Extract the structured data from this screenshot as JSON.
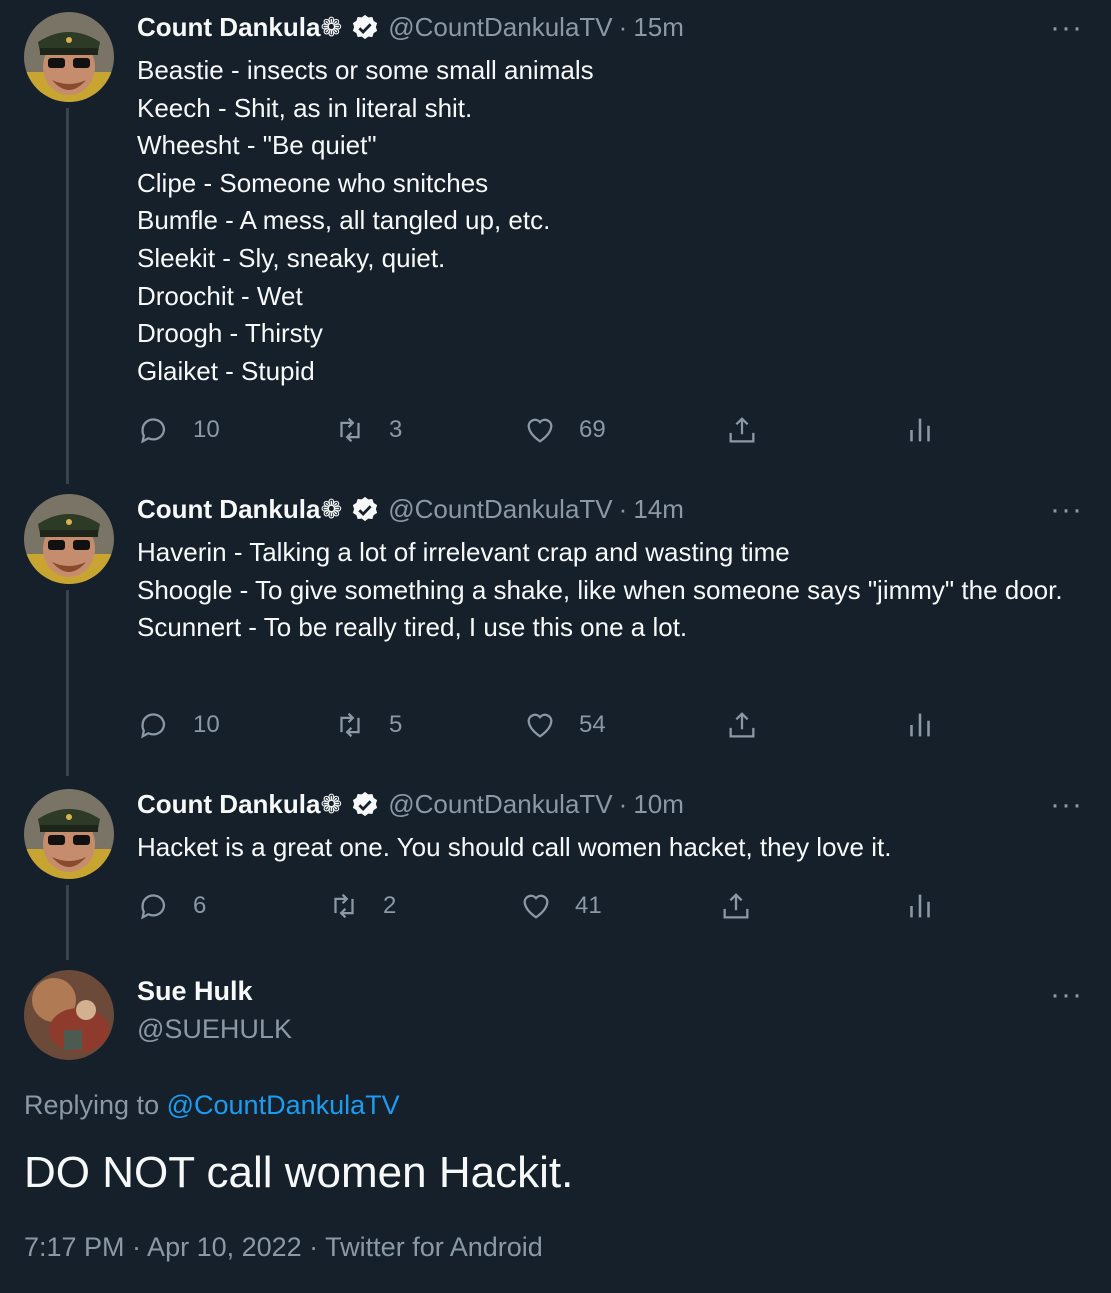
{
  "thread": [
    {
      "name": "Count Dankula🚖",
      "name_text": "Count Dankula",
      "name_emoji": "❁",
      "handle": "@CountDankulaTV",
      "time": "15m",
      "lines": [
        "Beastie - insects or some small animals",
        "Keech - Shit, as in literal shit.",
        "Wheesht - \"Be quiet\"",
        "Clipe - Someone who snitches",
        "Bumfle - A mess, all tangled up, etc.",
        "Sleekit - Sly, sneaky, quiet.",
        "Droochit - Wet",
        "Droogh - Thirsty",
        "Glaiket - Stupid"
      ],
      "replies": "10",
      "retweets": "3",
      "likes": "69"
    },
    {
      "name_text": "Count Dankula",
      "name_emoji": "❁",
      "handle": "@CountDankulaTV",
      "time": "14m",
      "lines": [
        "Haverin - Talking a lot of irrelevant crap and wasting time",
        "Shoogle - To give something a shake, like when someone says \"jimmy\" the door.",
        "Scunnert - To be really tired, I use this one a lot."
      ],
      "replies": "10",
      "retweets": "5",
      "likes": "54"
    },
    {
      "name_text": "Count Dankula",
      "name_emoji": "❁",
      "handle": "@CountDankulaTV",
      "time": "10m",
      "lines": [
        "Hacket is a great one. You should call women hacket, they love it."
      ],
      "replies": "6",
      "retweets": "2",
      "likes": "41"
    }
  ],
  "main_tweet": {
    "name": "Sue Hulk",
    "handle": "@SUEHULK",
    "replying_prefix": "Replying to",
    "replying_to": "@CountDankulaTV",
    "text": "DO NOT call women Hackit.",
    "meta": "7:17 PM · Apr 10, 2022 · Twitter for Android"
  },
  "icons": {
    "reply": "reply-icon",
    "retweet": "retweet-icon",
    "like": "heart-icon",
    "share": "share-icon",
    "analytics": "analytics-icon",
    "more": "more-icon",
    "verified": "verified-badge-icon"
  },
  "colors": {
    "background": "#15202b",
    "text": "#f7f9f9",
    "secondary": "#8b98a5",
    "link": "#1d9bf0",
    "thread_line": "#38444d"
  }
}
